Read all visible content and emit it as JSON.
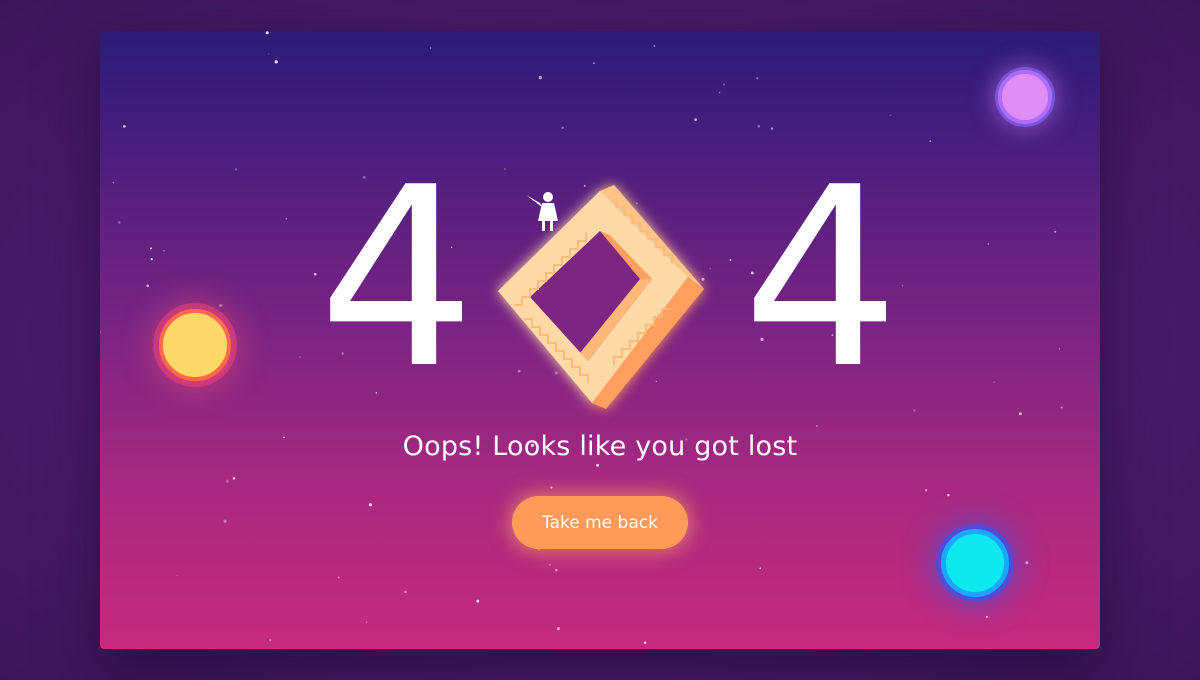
{
  "error_page": {
    "digit_left": "4",
    "digit_right": "4",
    "message": "Oops! Looks like you got lost",
    "button_label": "Take me back"
  },
  "colors": {
    "page_background": "#4a1c6b",
    "card_gradient_top": "#2b1b78",
    "card_gradient_bottom": "#c72a7e",
    "stairs_light": "#ffd7a0",
    "stairs_dark": "#ff9a5a",
    "button_background": "#ff9a5a",
    "planet_yellow": "#ffd86a",
    "planet_violet": "#e08ef6",
    "planet_cyan": "#0ee9ee",
    "text": "#ffffff"
  },
  "icons": {
    "zero_illustration": "impossible-staircase-icon",
    "figure": "little-girl-with-flag-icon",
    "decorations": [
      "yellow-planet-icon",
      "violet-planet-icon",
      "cyan-planet-icon",
      "star-dots"
    ]
  }
}
